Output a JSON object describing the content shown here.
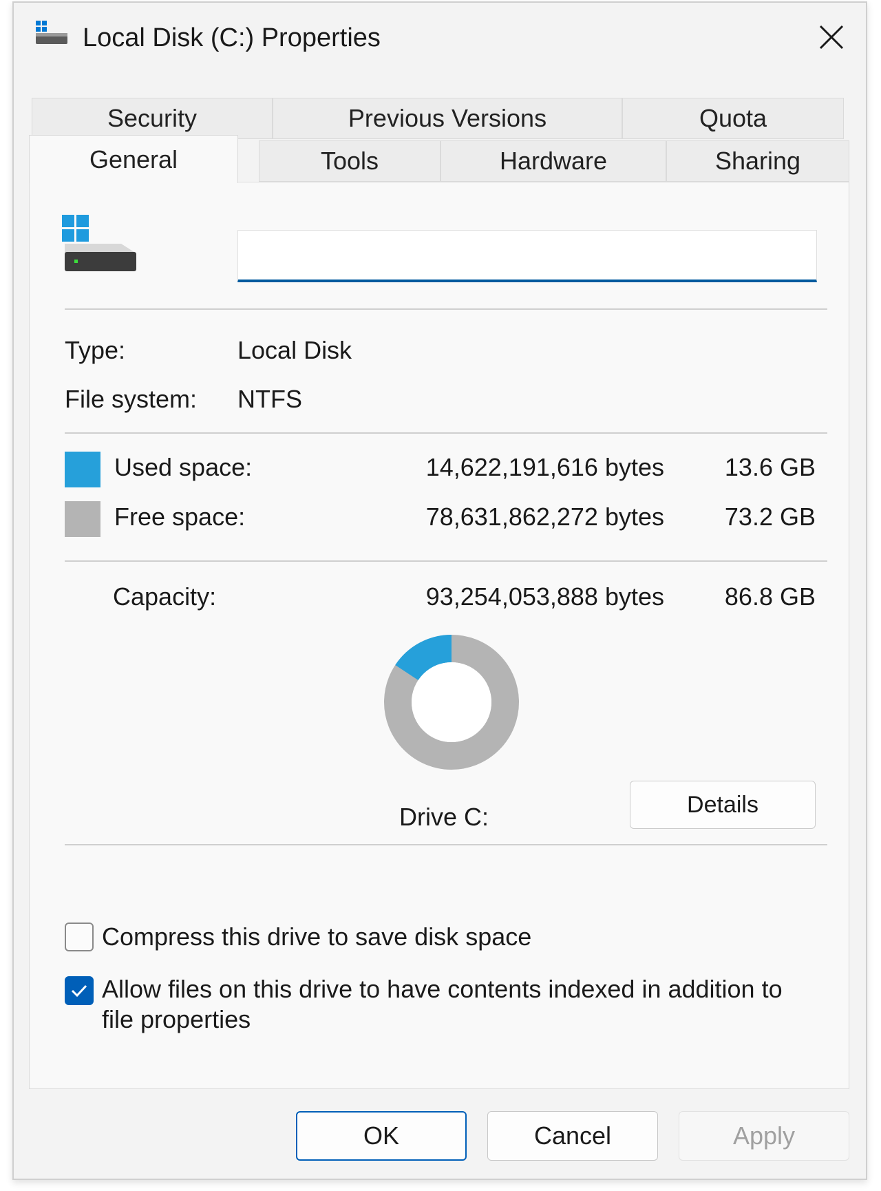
{
  "window": {
    "title": "Local Disk (C:) Properties"
  },
  "tabs": {
    "top_row": [
      {
        "label": "Security"
      },
      {
        "label": "Previous Versions"
      },
      {
        "label": "Quota"
      }
    ],
    "bottom_row": [
      {
        "label": "General",
        "active": true
      },
      {
        "label": "Tools"
      },
      {
        "label": "Hardware"
      },
      {
        "label": "Sharing"
      }
    ]
  },
  "general": {
    "name_value": "",
    "type_label": "Type:",
    "type_value": "Local Disk",
    "fs_label": "File system:",
    "fs_value": "NTFS",
    "used": {
      "label": "Used space:",
      "bytes": "14,622,191,616 bytes",
      "size": "13.6 GB",
      "color": "#26a0da"
    },
    "free": {
      "label": "Free space:",
      "bytes": "78,631,862,272 bytes",
      "size": "73.2 GB",
      "color": "#b4b4b4"
    },
    "capacity": {
      "label": "Capacity:",
      "bytes": "93,254,053,888 bytes",
      "size": "86.8 GB"
    },
    "donut": {
      "used_fraction": 0.157
    },
    "drive_label": "Drive C:",
    "details_label": "Details",
    "compress": {
      "label": "Compress this drive to save disk space",
      "checked": false
    },
    "index": {
      "line1": "Allow files on this drive to have contents indexed in addition to",
      "line2": "file properties",
      "checked": true
    }
  },
  "buttons": {
    "ok": "OK",
    "cancel": "Cancel",
    "apply": "Apply"
  },
  "colors": {
    "accent": "#005fb8",
    "used": "#26a0da",
    "free": "#b4b4b4"
  }
}
